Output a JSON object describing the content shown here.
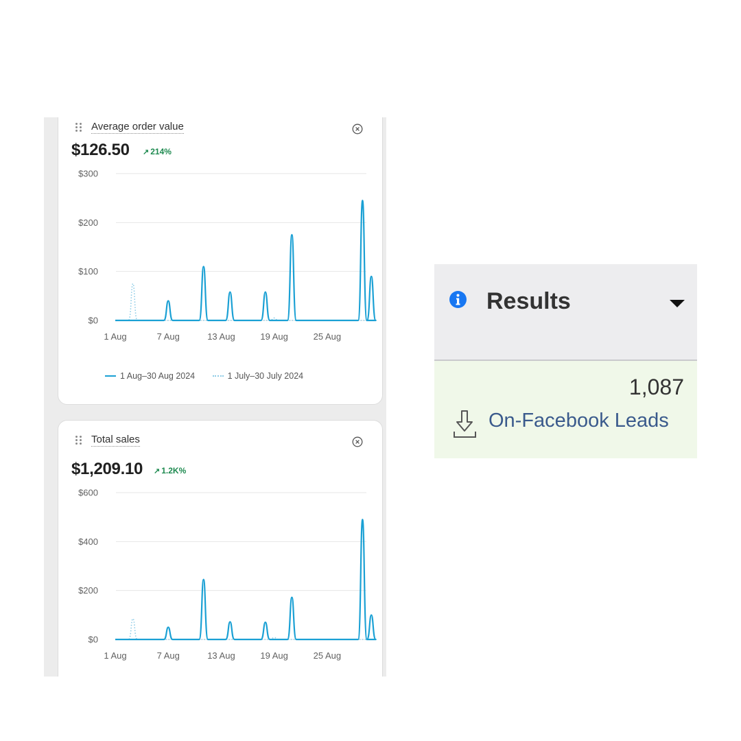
{
  "colors": {
    "current_series": "#1aa0d4",
    "previous_series": "#8ccbe6",
    "positive_change": "#1e8a50",
    "link": "#3a5a8c",
    "info_icon": "#1877f2",
    "results_body": "#f0f8e9"
  },
  "dashboard": {
    "cards": [
      {
        "title": "Average order value",
        "value": "$126.50",
        "change": "214%",
        "drag_icon": "drag-handle-icon",
        "close_icon": "close-circle-icon"
      },
      {
        "title": "Total sales",
        "value": "$1,209.10",
        "change": "1.2K%",
        "drag_icon": "drag-handle-icon",
        "close_icon": "close-circle-icon"
      }
    ],
    "legend": {
      "current": "1 Aug–30 Aug 2024",
      "previous": "1 July–30 July 2024"
    }
  },
  "chart_data": [
    {
      "type": "line",
      "x_tick_labels": [
        "1 Aug",
        "7 Aug",
        "13 Aug",
        "19 Aug",
        "25 Aug"
      ],
      "y_tick_labels": [
        "$0",
        "$100",
        "$200",
        "$300"
      ],
      "ylim": [
        0,
        300
      ],
      "xlim": [
        1,
        30
      ],
      "grid": true,
      "series": [
        {
          "name": "1 Aug–30 Aug 2024",
          "style": "solid",
          "x": [
            1,
            2,
            3,
            4,
            5,
            6,
            7,
            8,
            9,
            10,
            11,
            12,
            13,
            14,
            15,
            16,
            17,
            18,
            19,
            20,
            21,
            22,
            23,
            24,
            25,
            26,
            27,
            28,
            29,
            30
          ],
          "y": [
            0,
            0,
            0,
            0,
            0,
            0,
            40,
            0,
            0,
            0,
            110,
            0,
            0,
            58,
            0,
            0,
            0,
            58,
            0,
            0,
            175,
            0,
            0,
            0,
            0,
            0,
            0,
            0,
            245,
            90
          ]
        },
        {
          "name": "1 July–30 July 2024",
          "style": "dotted",
          "x": [
            1,
            2,
            3,
            4,
            5,
            6,
            7,
            8,
            9,
            10,
            11,
            12,
            13,
            14,
            15,
            16,
            17,
            18,
            19,
            20,
            21,
            22,
            23,
            24,
            25,
            26,
            27,
            28,
            29,
            30
          ],
          "y": [
            0,
            0,
            75,
            0,
            0,
            0,
            0,
            0,
            0,
            0,
            0,
            0,
            0,
            0,
            0,
            0,
            0,
            0,
            5,
            0,
            0,
            0,
            0,
            0,
            0,
            0,
            0,
            0,
            0,
            0
          ]
        }
      ]
    },
    {
      "type": "line",
      "x_tick_labels": [
        "1 Aug",
        "7 Aug",
        "13 Aug",
        "19 Aug",
        "25 Aug"
      ],
      "y_tick_labels": [
        "$0",
        "$200",
        "$400",
        "$600"
      ],
      "ylim": [
        0,
        600
      ],
      "xlim": [
        1,
        30
      ],
      "grid": true,
      "series": [
        {
          "name": "1 Aug–30 Aug 2024",
          "style": "solid",
          "x": [
            1,
            2,
            3,
            4,
            5,
            6,
            7,
            8,
            9,
            10,
            11,
            12,
            13,
            14,
            15,
            16,
            17,
            18,
            19,
            20,
            21,
            22,
            23,
            24,
            25,
            26,
            27,
            28,
            29,
            30
          ],
          "y": [
            0,
            0,
            0,
            0,
            0,
            0,
            50,
            0,
            0,
            0,
            245,
            0,
            0,
            72,
            0,
            0,
            0,
            70,
            0,
            0,
            172,
            0,
            0,
            0,
            0,
            0,
            0,
            0,
            490,
            100
          ]
        },
        {
          "name": "1 July–30 July 2024",
          "style": "dotted",
          "x": [
            1,
            2,
            3,
            4,
            5,
            6,
            7,
            8,
            9,
            10,
            11,
            12,
            13,
            14,
            15,
            16,
            17,
            18,
            19,
            20,
            21,
            22,
            23,
            24,
            25,
            26,
            27,
            28,
            29,
            30
          ],
          "y": [
            0,
            0,
            85,
            0,
            0,
            0,
            0,
            0,
            0,
            0,
            0,
            0,
            0,
            0,
            0,
            0,
            0,
            0,
            8,
            0,
            0,
            0,
            0,
            0,
            0,
            0,
            0,
            0,
            0,
            0
          ]
        }
      ]
    }
  ],
  "results": {
    "title": "Results",
    "info_icon": "info-icon",
    "dropdown_icon": "caret-down-icon",
    "value": "1,087",
    "link": "On-Facebook Leads",
    "link_icon": "download-icon"
  }
}
